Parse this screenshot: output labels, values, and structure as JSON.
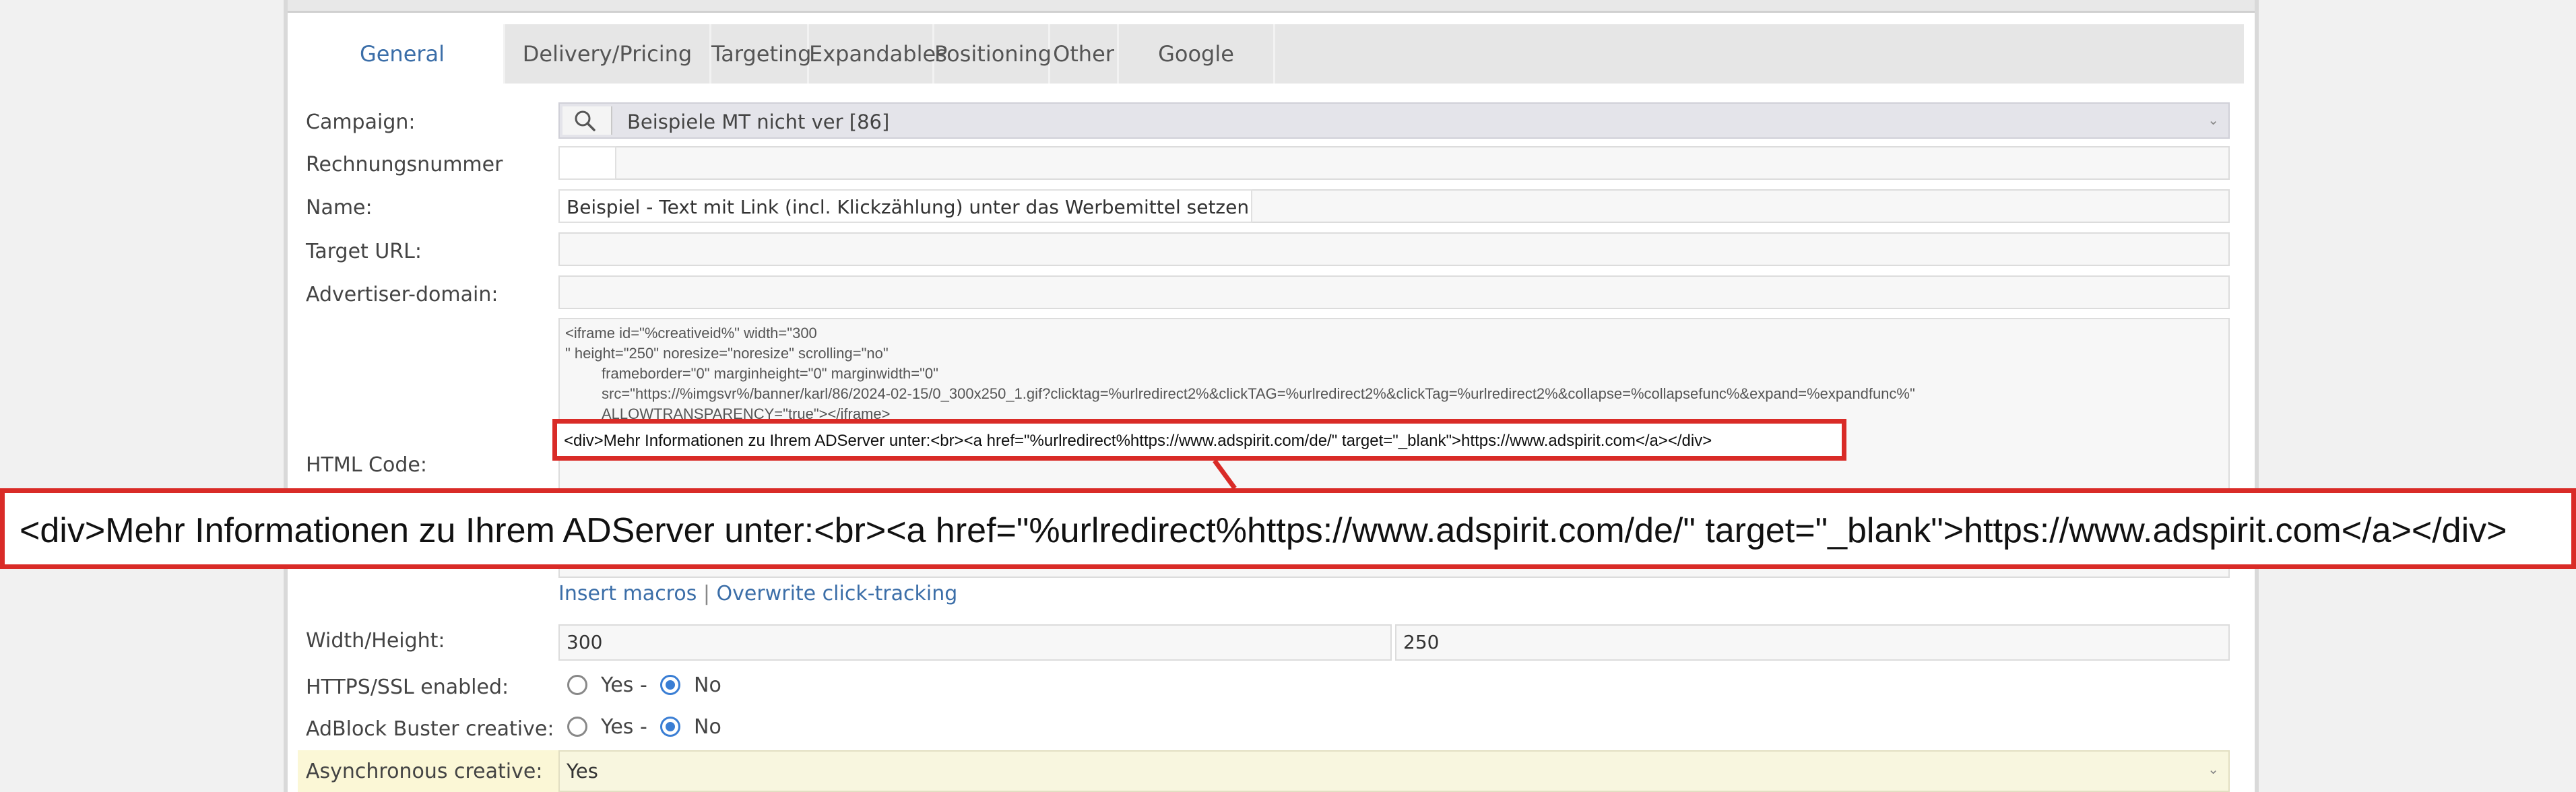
{
  "tabs": [
    {
      "label": "General",
      "active": true
    },
    {
      "label": "Delivery/Pricing"
    },
    {
      "label": "Targeting"
    },
    {
      "label": "Expandables"
    },
    {
      "label": "Positioning"
    },
    {
      "label": "Other"
    },
    {
      "label": "Google analytics"
    }
  ],
  "form": {
    "campaign_label": "Campaign:",
    "campaign_value": "Beispiele MT nicht ver [86]",
    "invoice_label": "Rechnungsnummer",
    "name_label": "Name:",
    "name_value": "Beispiel - Text mit Link (incl. Klickzählung) unter das Werbemittel setzen",
    "target_url_label": "Target URL:",
    "advertiser_domain_label": "Advertiser-domain:",
    "html_code_label": "HTML Code:",
    "html_code_lines": [
      "<iframe id=\"%creativeid%\" width=\"300",
      "\" height=\"250\" noresize=\"noresize\" scrolling=\"no\"",
      "frameborder=\"0\" marginheight=\"0\" marginwidth=\"0\"",
      "src=\"https://%imgsvr%/banner/karl/86/2024-02-15/0_300x250_1.gif?clicktag=%urlredirect2%&clickTAG=%urlredirect2%&clickTag=%urlredirect2%&collapse=%collapsefunc%&expand=%expandfunc%\"",
      "ALLOWTRANSPARENCY=\"true\"></iframe>"
    ],
    "highlight_snippet": "<div>Mehr Informationen zu Ihrem ADServer unter:<br><a href=\"%urlredirect%https://www.adspirit.com/de/\" target=\"_blank\">https://www.adspirit.com</a></div>",
    "insert_macros_link": "Insert macros",
    "link_separator": "|",
    "overwrite_click_link": "Overwrite click-tracking",
    "width_height_label": "Width/Height:",
    "width_value": "300",
    "height_value": "250",
    "https_label": "HTTPS/SSL enabled:",
    "adblock_label": "AdBlock Buster creative:",
    "yes_label": "Yes -",
    "no_label": "No",
    "async_label": "Asynchronous creative:",
    "async_value": "Yes"
  },
  "colors": {
    "highlight_border": "#d92b27",
    "link": "#3b6ea8",
    "radio_selected": "#3a7ed4"
  }
}
